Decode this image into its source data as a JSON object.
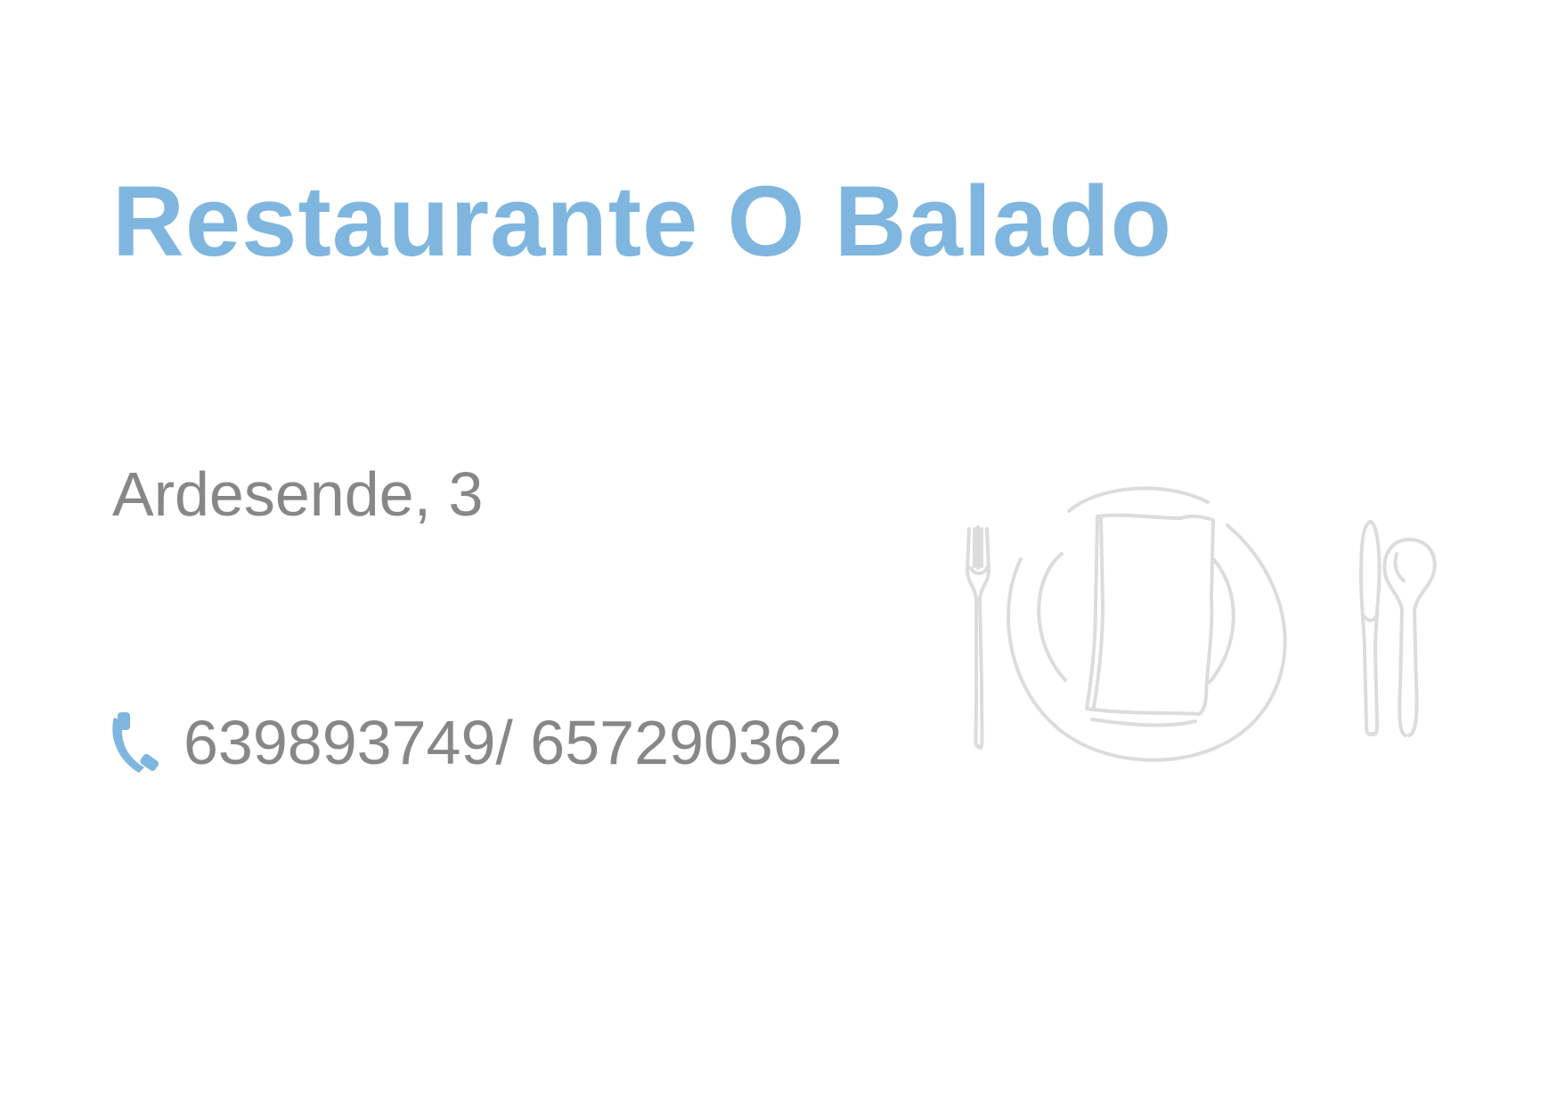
{
  "card": {
    "title": "Restaurante O Balado",
    "address": "Ardesende, 3",
    "phone": "639893749/ 657290362"
  },
  "icons": {
    "phone": "phone-icon",
    "illustration": "place-setting-illustration"
  },
  "colors": {
    "accent": "#7fb6df",
    "text": "#878787",
    "illustration": "#dcdcdc",
    "background": "#ffffff"
  }
}
